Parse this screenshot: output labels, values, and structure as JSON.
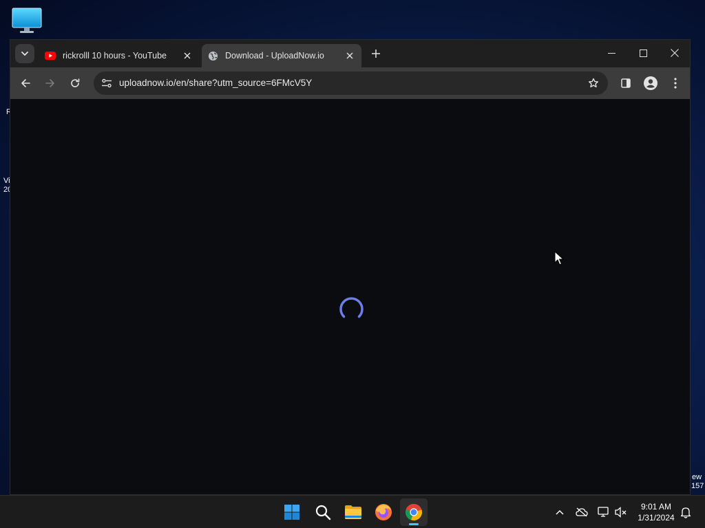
{
  "desktop": {
    "edge_text_left": [
      "R",
      "Vi",
      "20"
    ],
    "edge_text_right": [
      "ew",
      "157"
    ]
  },
  "browser": {
    "tabs": [
      {
        "title": "rickrolll 10 hours - YouTube",
        "favicon": "youtube-icon",
        "active": false
      },
      {
        "title": "Download - UploadNow.io",
        "favicon": "globe-icon",
        "active": true
      }
    ],
    "new_tab_label": "+",
    "window_controls": [
      "minimize",
      "maximize",
      "close"
    ],
    "address_bar": {
      "url": "uploadnow.io/en/share?utm_source=6FMcV5Y"
    },
    "page_state": "loading",
    "spinner_color": "#6b7fe6"
  },
  "taskbar": {
    "apps": [
      "start-icon",
      "search-icon",
      "file-explorer-icon",
      "firefox-icon",
      "chrome-icon"
    ],
    "active_app": "chrome-icon",
    "clock": {
      "time": "9:01 AM",
      "date": "1/31/2024"
    }
  },
  "colors": {
    "tabstrip": "#1f1f1f",
    "toolbar": "#3c3c3c",
    "page_bg": "#0b0c0f",
    "taskbar": "#1c1c1c"
  }
}
